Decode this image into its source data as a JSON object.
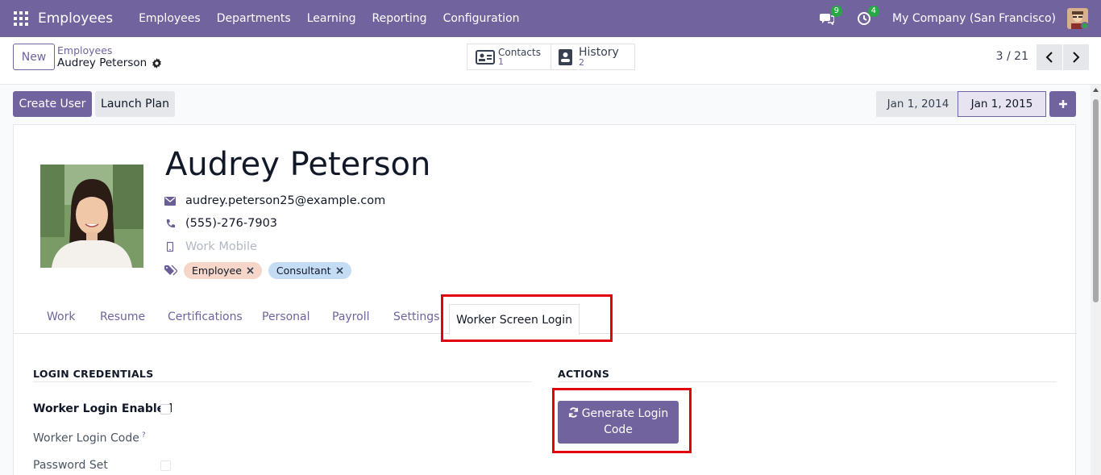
{
  "navbar": {
    "app_name": "Employees",
    "menu": [
      "Employees",
      "Departments",
      "Learning",
      "Reporting",
      "Configuration"
    ],
    "messages_count": "9",
    "activities_count": "4",
    "company": "My Company (San Francisco)"
  },
  "control_panel": {
    "new_label": "New",
    "breadcrumb_parent": "Employees",
    "breadcrumb_current": "Audrey Peterson",
    "smart_buttons": [
      {
        "label": "Contacts",
        "value": "1"
      },
      {
        "label": "History",
        "value": "2"
      }
    ],
    "pager": "3 / 21"
  },
  "statusbar": {
    "create_user": "Create User",
    "launch_plan": "Launch Plan",
    "stages": [
      "Jan 1, 2014",
      "Jan 1, 2015"
    ]
  },
  "employee": {
    "name": "Audrey Peterson",
    "email": "audrey.peterson25@example.com",
    "phone": "(555)-276-7903",
    "mobile_placeholder": "Work Mobile",
    "tags": [
      "Employee",
      "Consultant"
    ]
  },
  "tabs": [
    "Work",
    "Resume",
    "Certifications",
    "Personal",
    "Payroll",
    "Settings",
    "Worker Screen Login"
  ],
  "login_section": {
    "title": "LOGIN CREDENTIALS",
    "fields": [
      "Worker Login Enabled",
      "Worker Login Code",
      "Password Set"
    ],
    "help_mark": "?"
  },
  "actions_section": {
    "title": "ACTIONS",
    "generate_line1": "Generate Login",
    "generate_line2": "Code"
  },
  "colors": {
    "brand": "#71639e",
    "highlight": "#e2000f"
  }
}
